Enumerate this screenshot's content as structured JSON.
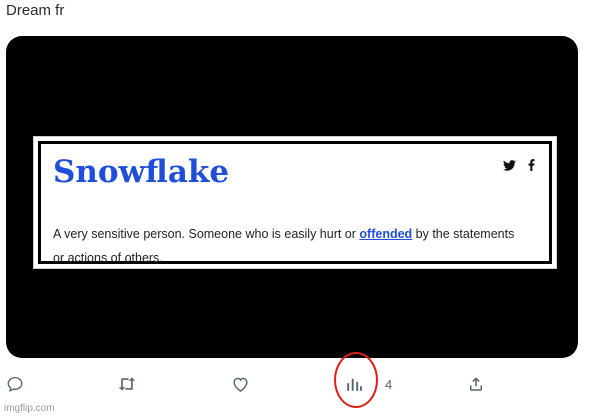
{
  "tweet": {
    "text": "Dream fr"
  },
  "media": {
    "definition": {
      "word": "Snowflake",
      "text_before_link": "A very sensitive person. Someone who is easily hurt or ",
      "link_text": "offended",
      "text_after_link": " by the statements or actions of others.",
      "share_icons": [
        "twitter-icon",
        "facebook-icon"
      ],
      "accent_color": "#1f4fd8"
    }
  },
  "actions": {
    "reply_icon": "reply-icon",
    "retweet_icon": "retweet-icon",
    "like_icon": "like-icon",
    "views_icon": "views-icon",
    "views_count": "4",
    "share_icon": "share-icon"
  },
  "annotation": {
    "circle_color": "#e0201b"
  },
  "watermark": {
    "text": "imgflip.com"
  }
}
